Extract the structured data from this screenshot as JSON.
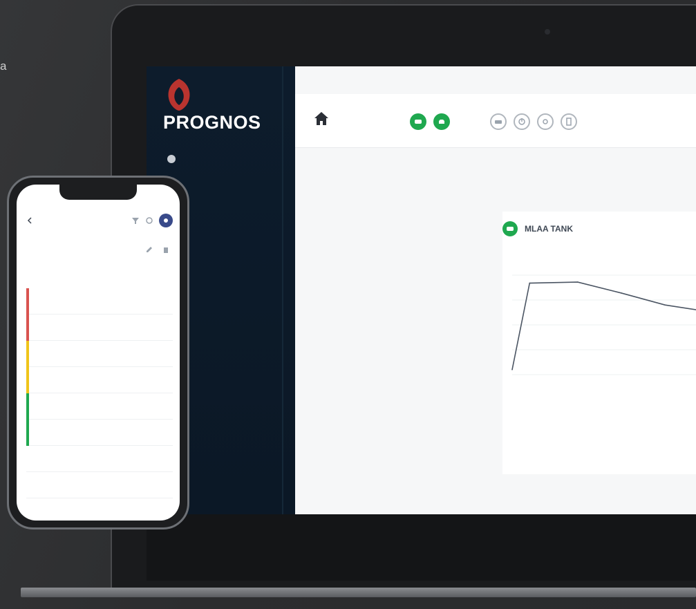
{
  "page": {
    "edge_text": "a"
  },
  "laptop": {
    "brand": "PROGNOS",
    "user_name": "",
    "nav_items": [
      {
        "label": ""
      },
      {
        "label": ""
      },
      {
        "label": ""
      },
      {
        "label": ""
      },
      {
        "label": ""
      },
      {
        "label": ""
      },
      {
        "label": ""
      }
    ],
    "breadcrumb": "",
    "site": {
      "name": "",
      "subtitle": ""
    },
    "filters": {
      "from_label": "",
      "from_value": "",
      "to_label": "",
      "to_value": ""
    },
    "cards": [
      {
        "title": "MLAA TANK",
        "meta_line1": "",
        "meta_line2": "",
        "badge": "",
        "footer_line1": "",
        "footer_line2": "",
        "icon": "tank-icon",
        "color": "#1fa84f"
      },
      {
        "title": "",
        "meta_line1": "",
        "meta_line2": "",
        "badge": "",
        "footer_line1": "",
        "footer_line2": "",
        "icon": "tank-icon",
        "color": "#1fa84f"
      }
    ],
    "toolbar_icons": [
      "tank-icon",
      "tank-icon",
      "vehicle-icon",
      "power-icon",
      "settings-icon",
      "document-icon"
    ]
  },
  "chart_data": [
    {
      "type": "line",
      "title": "",
      "xlabel": "",
      "ylabel": "",
      "x": [
        0,
        0.08,
        0.3,
        0.5,
        0.7,
        0.85,
        1.0
      ],
      "y": [
        0.05,
        0.92,
        0.93,
        0.82,
        0.7,
        0.65,
        0.65
      ]
    },
    {
      "type": "line",
      "title": "",
      "xlabel": "",
      "ylabel": "",
      "x": [
        0,
        0.08,
        0.3
      ],
      "y": [
        0.05,
        0.88,
        0.9
      ]
    }
  ],
  "phone": {
    "time": "",
    "status": "",
    "title": "",
    "section": "",
    "items": [
      {
        "label": "",
        "value": "",
        "color": "#d9534f"
      },
      {
        "label": "",
        "value": "",
        "color": "#d9534f"
      },
      {
        "label": "",
        "value": "",
        "color": "#f0c419"
      },
      {
        "label": "",
        "value": "",
        "color": "#f0c419"
      },
      {
        "label": "",
        "value": "",
        "color": "#1fa84f"
      },
      {
        "label": "",
        "value": "",
        "color": "#1fa84f"
      },
      {
        "label": "",
        "value": "",
        "color": "#ffffff"
      },
      {
        "label": "",
        "value": "",
        "color": "#ffffff"
      }
    ]
  },
  "colors": {
    "accent_green": "#1fa84f",
    "sidebar_bg": "#0d1c2c",
    "brand_red": "#d9534f",
    "nav_purple": "#394a8a"
  }
}
